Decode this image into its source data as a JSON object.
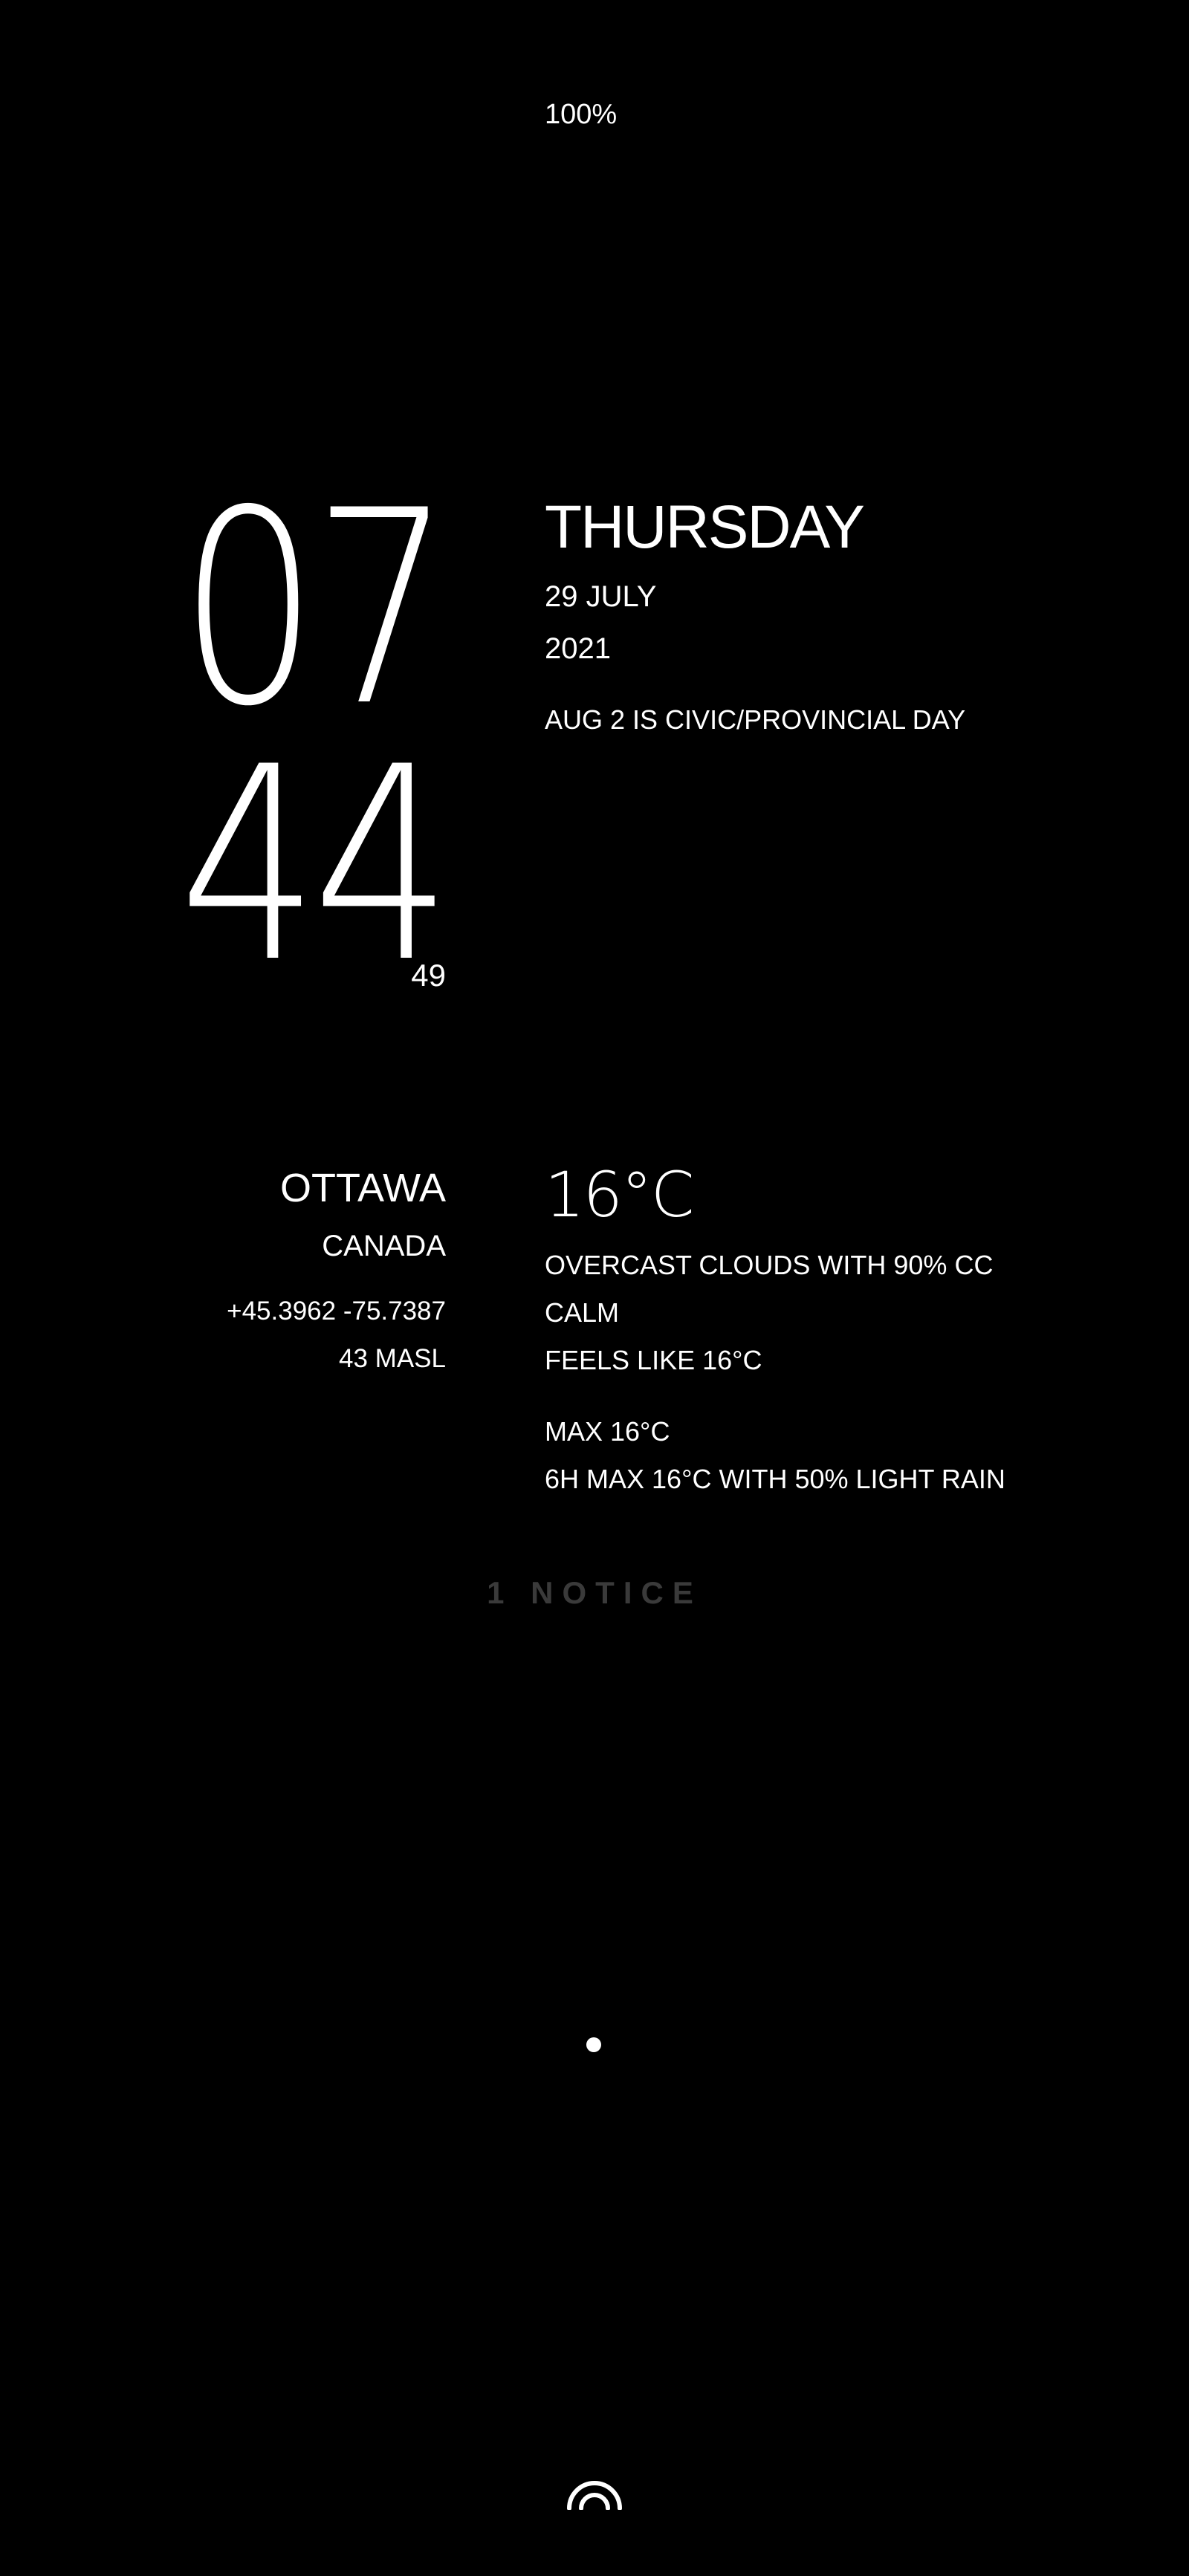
{
  "status": {
    "battery": "100%"
  },
  "clock": {
    "hour": "07",
    "minute": "44",
    "second": "49"
  },
  "date": {
    "weekday": "THURSDAY",
    "day_month": "29 JULY",
    "year": "2021",
    "holiday": "AUG 2 IS CIVIC/PROVINCIAL DAY"
  },
  "location": {
    "city": "OTTAWA",
    "country": "CANADA",
    "coordinates": "+45.3962 -75.7387",
    "altitude": "43 MASL"
  },
  "weather": {
    "temperature": "16°C",
    "condition": "OVERCAST CLOUDS WITH 90% CC",
    "wind": "CALM",
    "feels_like": "FEELS LIKE 16°C",
    "max": "MAX 16°C",
    "forecast": "6H MAX 16°C WITH 50% LIGHT RAIN"
  },
  "notifications": {
    "label": "1 NOTICE"
  },
  "icons": {
    "unlock": "fingerprint-icon",
    "pager": "page-indicator-dot"
  },
  "colors": {
    "background": "#000000",
    "text": "#ffffff",
    "notice": "#3a3a3a"
  }
}
